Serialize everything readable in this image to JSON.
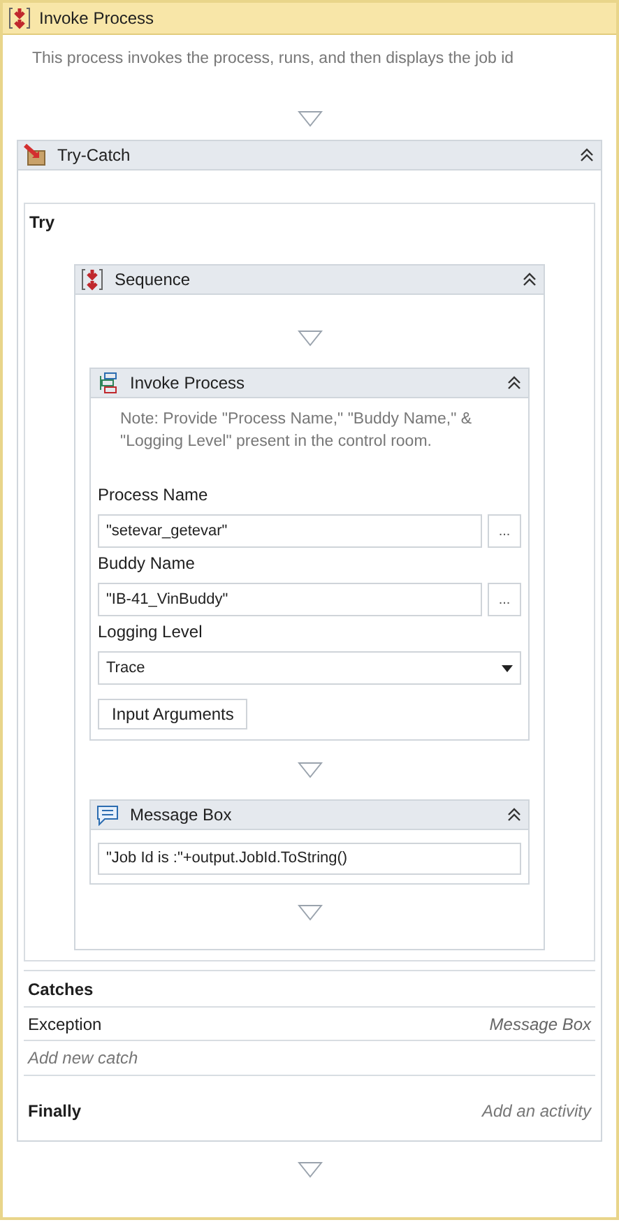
{
  "title": "Invoke Process",
  "annotation": "This process invokes the process, runs, and then displays the job id",
  "try_catch": {
    "title": "Try-Catch",
    "try_label": "Try",
    "sequence": {
      "title": "Sequence",
      "activities": [
        {
          "kind": "invoke_process",
          "title": "Invoke Process",
          "note": "Note: Provide \"Process Name,\" \"Buddy Name,\" & \"Logging Level\" present in the control room.",
          "fields": [
            {
              "kind": "text",
              "label": "Process Name",
              "value": "\"setevar_getevar\"",
              "button": "..."
            },
            {
              "kind": "text",
              "label": "Buddy Name",
              "value": "\"IB-41_VinBuddy\"",
              "button": "..."
            },
            {
              "kind": "select",
              "label": "Logging Level",
              "value": "Trace"
            }
          ],
          "args_button": "Input Arguments"
        },
        {
          "kind": "message_box",
          "title": "Message Box",
          "value": "\"Job Id is :\"+output.JobId.ToString()"
        }
      ]
    },
    "catches_label": "Catches",
    "catches": [
      {
        "exception": "Exception",
        "handler": "Message Box"
      }
    ],
    "add_catch": "Add new catch",
    "finally_label": "Finally",
    "finally_placeholder": "Add an activity"
  }
}
